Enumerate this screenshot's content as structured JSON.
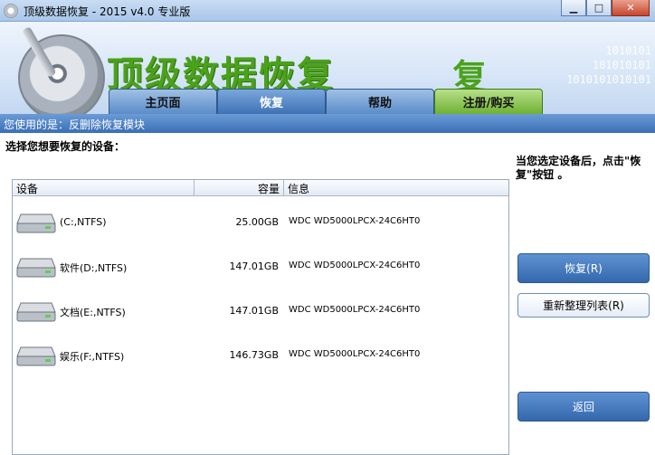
{
  "window": {
    "title": "顶级数据恢复 - 2015 v4.0 专业版",
    "controls": {
      "minimize": "▁",
      "maximize": "□",
      "close": "✕"
    }
  },
  "banner": {
    "title": "顶级数据恢复",
    "ghost_char": "复",
    "binary_lines": [
      "1010101",
      "101010101",
      "1010101010101"
    ]
  },
  "tabs": [
    {
      "label": "主页面",
      "state": "normal"
    },
    {
      "label": "恢复",
      "state": "active"
    },
    {
      "label": "帮助",
      "state": "normal"
    },
    {
      "label": "注册/购买",
      "state": "green"
    }
  ],
  "module_bar": {
    "text": "您使用的是：反删除恢复模块"
  },
  "main": {
    "prompt": "选择您想要恢复的设备：",
    "hint": "当您选定设备后，点击\"恢复\"按钮 。"
  },
  "device_table": {
    "headers": {
      "device": "设备",
      "capacity": "容量",
      "info": "信息"
    },
    "rows": [
      {
        "name": "(C:,NTFS)",
        "capacity": "25.00GB",
        "info": "WDC WD5000LPCX-24C6HT0"
      },
      {
        "name": "软件(D:,NTFS)",
        "capacity": "147.01GB",
        "info": "WDC WD5000LPCX-24C6HT0"
      },
      {
        "name": "文档(E:,NTFS)",
        "capacity": "147.01GB",
        "info": "WDC WD5000LPCX-24C6HT0"
      },
      {
        "name": "娱乐(F:,NTFS)",
        "capacity": "146.73GB",
        "info": "WDC WD5000LPCX-24C6HT0"
      }
    ]
  },
  "buttons": {
    "recover": "恢复(R)",
    "refresh": "重新整理列表(R)",
    "back": "返回"
  },
  "colors": {
    "accent": "#3e72b6",
    "brand_green": "#4aa21a",
    "register_tab": "#6fb033"
  }
}
